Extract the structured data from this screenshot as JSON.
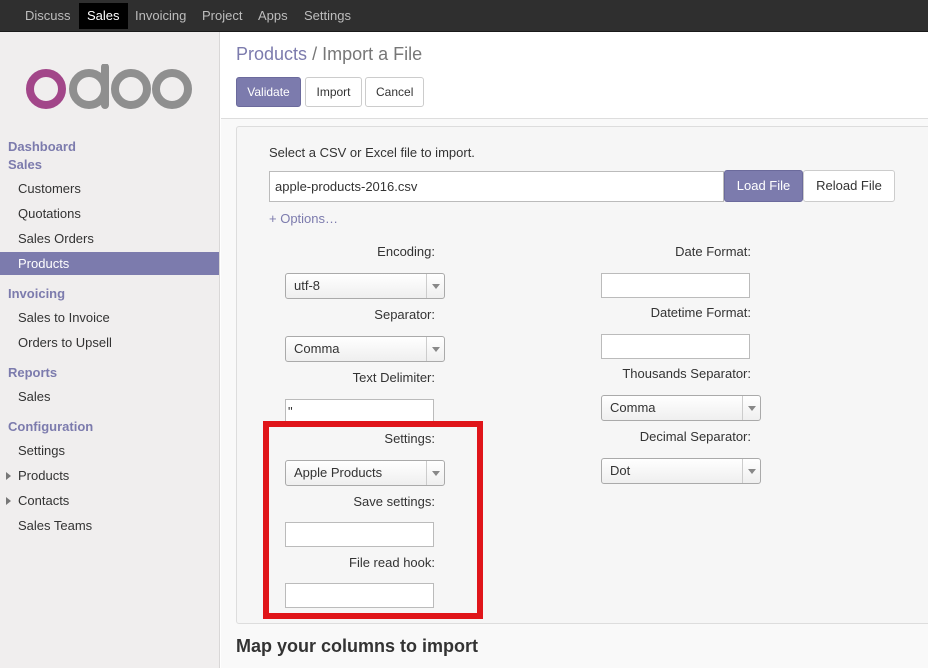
{
  "topbar": {
    "items": [
      "Discuss",
      "Sales",
      "Invoicing",
      "Project",
      "Apps",
      "Settings"
    ],
    "active": "Sales"
  },
  "sidebar": {
    "logo_text": "odoo",
    "sections": {
      "dashboard": "Dashboard",
      "sales": "Sales",
      "invoicing": "Invoicing",
      "reports": "Reports",
      "configuration": "Configuration"
    },
    "items": {
      "customers": "Customers",
      "quotations": "Quotations",
      "sales_orders": "Sales Orders",
      "products": "Products",
      "sales_to_invoice": "Sales to Invoice",
      "orders_to_upsell": "Orders to Upsell",
      "report_sales": "Sales",
      "config_settings": "Settings",
      "config_products": "Products",
      "config_contacts": "Contacts",
      "config_sales_teams": "Sales Teams"
    }
  },
  "breadcrumb": {
    "parent": "Products",
    "separator": "/",
    "current": "Import a File"
  },
  "buttons": {
    "validate": "Validate",
    "import": "Import",
    "cancel": "Cancel",
    "load_file": "Load File",
    "reload_file": "Reload File"
  },
  "import_form": {
    "intro": "Select a CSV or Excel file to import.",
    "file_name": "apple-products-2016.csv",
    "options_link": "+ Options…",
    "encoding_label": "Encoding:",
    "encoding_value": "utf-8",
    "separator_label": "Separator:",
    "separator_value": "Comma",
    "text_delimiter_label": "Text Delimiter:",
    "text_delimiter_value": "\"",
    "settings_label": "Settings:",
    "settings_value": "Apple Products",
    "save_settings_label": "Save settings:",
    "save_settings_value": "",
    "file_read_hook_label": "File read hook:",
    "file_read_hook_value": "",
    "date_format_label": "Date Format:",
    "date_format_value": "",
    "datetime_format_label": "Datetime Format:",
    "datetime_format_value": "",
    "thousands_separator_label": "Thousands Separator:",
    "thousands_separator_value": "Comma",
    "decimal_separator_label": "Decimal Separator:",
    "decimal_separator_value": "Dot"
  },
  "map_title": "Map your columns to import",
  "colors": {
    "brand": "#7c7bad",
    "topbar": "#2f2f2f",
    "highlight": "#e0151a"
  }
}
